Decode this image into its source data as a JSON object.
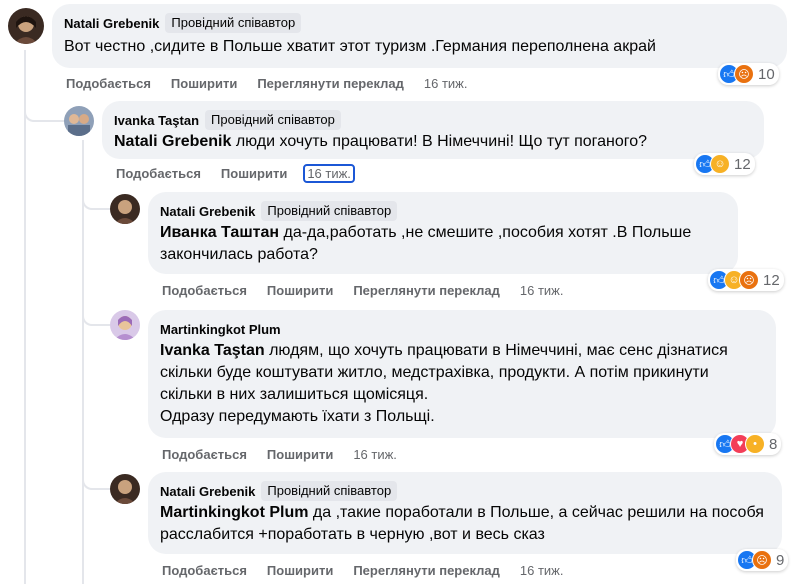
{
  "comments": [
    {
      "author": "Natali Grebenik",
      "badge": "Провідний співавтор",
      "mention": "",
      "text": "Вот честно ,сидите в Польше хватит этот туризм .Германия переполнена акрай",
      "like": "Подобається",
      "share": "Поширити",
      "translate": "Переглянути переклад",
      "time": "16 тиж.",
      "reactions": [
        "like-icon",
        "angry-icon"
      ],
      "reaction_count": "10"
    },
    {
      "author": "Ivanka Taştan",
      "badge": "Провідний співавтор",
      "mention": "Natali Grebenik",
      "text": " люди хочуть працювати! В Німеччині! Що тут поганого?",
      "like": "Подобається",
      "share": "Поширити",
      "time": "16 тиж.",
      "reactions": [
        "like-icon",
        "haha-icon"
      ],
      "reaction_count": "12"
    },
    {
      "author": "Natali Grebenik",
      "badge": "Провідний співавтор",
      "mention": "Иванка Таштан",
      "text": " да-да,работать ,не смешите ,пособия хотят .В Польше закончилась работа?",
      "like": "Подобається",
      "share": "Поширити",
      "translate": "Переглянути переклад",
      "time": "16 тиж.",
      "reactions": [
        "like-icon",
        "haha-icon",
        "angry-icon"
      ],
      "reaction_count": "12"
    },
    {
      "author": "Martinkingkot Plum",
      "badge": "",
      "mention": "Ivanka Taştan",
      "text": " людям, що хочуть працювати в Німеччині, має сенс дізнатися скільки буде коштувати житло, медстрахівка, продукти. А потім прикинути скільки в них залишиться щомісяця.\nОдразу передумають їхати з Польщі.",
      "like": "Подобається",
      "share": "Поширити",
      "time": "16 тиж.",
      "reactions": [
        "like-icon",
        "love-icon",
        "wow-icon"
      ],
      "reaction_count": "8"
    },
    {
      "author": "Natali Grebenik",
      "badge": "Провідний співавтор",
      "mention": "Martinkingkot Plum",
      "text": " да ,такие поработали в Польше, а сейчас решили на пособя расслабится +поработать в черную ,вот и весь сказ",
      "like": "Подобається",
      "share": "Поширити",
      "translate": "Переглянути переклад",
      "time": "16 тиж.",
      "reactions": [
        "like-icon",
        "angry-icon"
      ],
      "reaction_count": "9"
    }
  ],
  "colors": {
    "accent": "#1877f2",
    "bubble": "#f0f2f5",
    "meta": "#65676b",
    "focus": "#1b57d6"
  }
}
